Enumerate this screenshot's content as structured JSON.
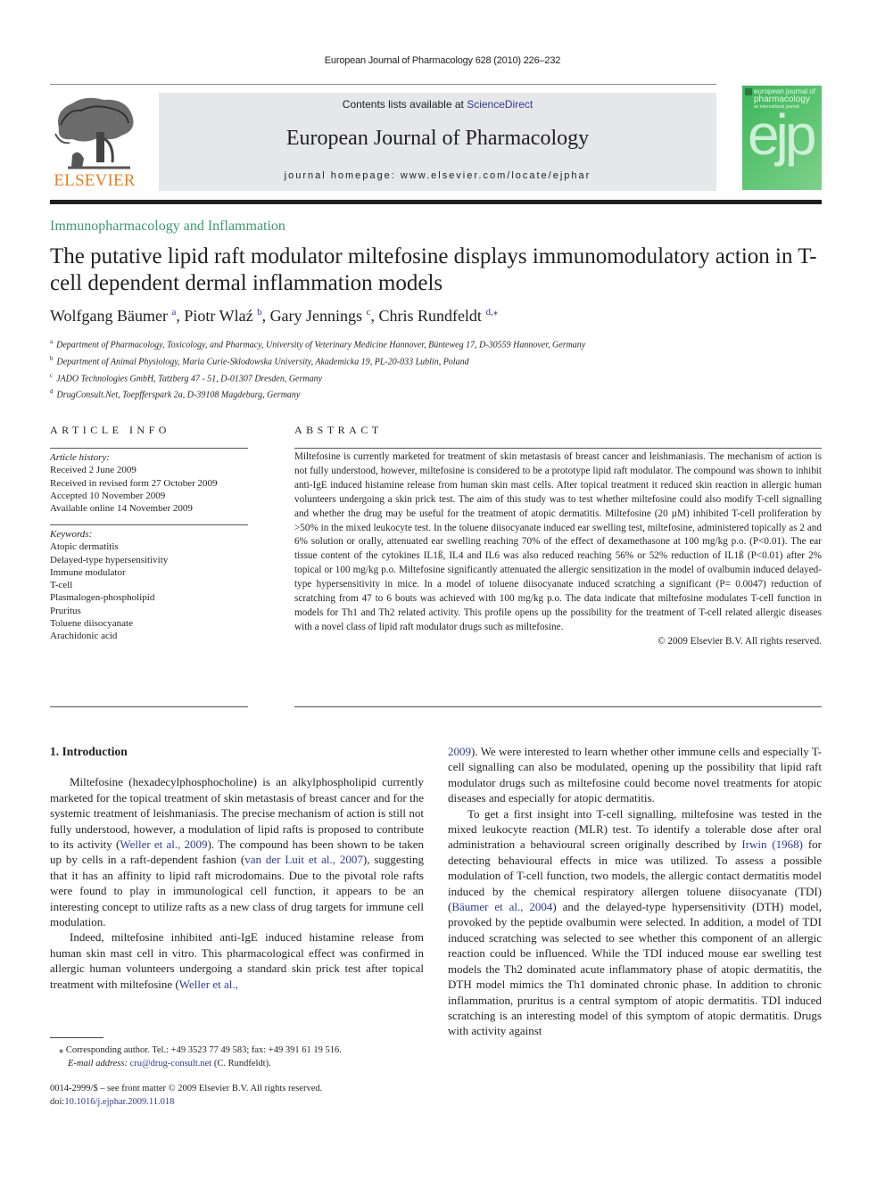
{
  "running_head": "European Journal of Pharmacology 628 (2010) 226–232",
  "masthead": {
    "publisher_logo_text": "ELSEVIER",
    "contents_prefix": "Contents lists available at ",
    "contents_link": "ScienceDirect",
    "journal_name": "European Journal of Pharmacology",
    "homepage": "journal homepage: www.elsevier.com/locate/ejphar",
    "cover": {
      "line1": "european journal of",
      "line2": "pharmacology",
      "line3": "an international journal",
      "monogram": "ejp",
      "color": "#3cb55a"
    }
  },
  "section": "Immunopharmacology and Inflammation",
  "title": "The putative lipid raft modulator miltefosine displays immunomodulatory action in T-cell dependent dermal inflammation models",
  "authors": [
    {
      "name": "Wolfgang Bäumer",
      "sup": "a",
      "sep": ", "
    },
    {
      "name": "Piotr Wlaź",
      "sup": "b",
      "sep": ", "
    },
    {
      "name": "Gary Jennings",
      "sup": "c",
      "sep": ", "
    },
    {
      "name": "Chris Rundfeldt",
      "sup": "d,⁎",
      "sep": ""
    }
  ],
  "affiliations": [
    {
      "key": "a",
      "text": "Department of Pharmacology, Toxicology, and Pharmacy, University of Veterinary Medicine Hannover, Bünteweg 17, D-30559 Hannover, Germany"
    },
    {
      "key": "b",
      "text": "Department of Animal Physiology, Maria Curie-Sklodowska University, Akademicka 19, PL-20-033 Lublin, Poland"
    },
    {
      "key": "c",
      "text": "JADO Technologies GmbH, Tatzberg 47 - 51, D-01307 Dresden, Germany"
    },
    {
      "key": "d",
      "text": "DrugConsult.Net, Toepfferspark 2a, D-39108 Magdeburg, Germany"
    }
  ],
  "article_info": {
    "heading": "ARTICLE INFO",
    "history_label": "Article history:",
    "history": [
      "Received 2 June 2009",
      "Received in revised form 27 October 2009",
      "Accepted 10 November 2009",
      "Available online 14 November 2009"
    ],
    "keywords_label": "Keywords:",
    "keywords": [
      "Atopic dermatitis",
      "Delayed-type hypersensitivity",
      "Immune modulator",
      "T-cell",
      "Plasmalogen-phospholipid",
      "Pruritus",
      "Toluene diisocyanate",
      "Arachidonic acid"
    ]
  },
  "abstract": {
    "heading": "ABSTRACT",
    "text": "Miltefosine is currently marketed for treatment of skin metastasis of breast cancer and leishmaniasis. The mechanism of action is not fully understood, however, miltefosine is considered to be a prototype lipid raft modulator. The compound was shown to inhibit anti-IgE induced histamine release from human skin mast cells. After topical treatment it reduced skin reaction in allergic human volunteers undergoing a skin prick test. The aim of this study was to test whether miltefosine could also modify T-cell signalling and whether the drug may be useful for the treatment of atopic dermatitis. Miltefosine (20 µM) inhibited T-cell proliferation by >50% in the mixed leukocyte test. In the toluene diisocyanate induced ear swelling test, miltefosine, administered topically as 2 and 6% solution or orally, attenuated ear swelling reaching 70% of the effect of dexamethasone at 100 mg/kg p.o. (P<0.01). The ear tissue content of the cytokines IL1ß, IL4 and IL6 was also reduced reaching 56% or 52% reduction of IL1ß (P<0.01) after 2% topical or 100 mg/kg p.o. Miltefosine significantly attenuated the allergic sensitization in the model of ovalbumin induced delayed-type hypersensitivity in mice. In a model of toluene diisocyanate induced scratching a significant (P= 0.0047) reduction of scratching from 47 to 6 bouts was achieved with 100 mg/kg p.o. The data indicate that miltefosine modulates T-cell function in models for Th1 and Th2 related activity. This profile opens up the possibility for the treatment of T-cell related allergic diseases with a novel class of lipid raft modulator drugs such as miltefosine.",
    "copyright": "© 2009 Elsevier B.V. All rights reserved."
  },
  "introduction": {
    "heading": "1. Introduction",
    "left_paragraphs": [
      [
        {
          "t": "Miltefosine (hexadecylphosphocholine) is an alkylphospholipid currently marketed for the topical treatment of skin metastasis of breast cancer and for the systemic treatment of leishmaniasis. The precise mechanism of action is still not fully understood, however, a modulation of lipid rafts is proposed to contribute to its activity ("
        },
        {
          "t": "Weller et al., 2009",
          "cite": true
        },
        {
          "t": "). The compound has been shown to be taken up by cells in a raft-dependent fashion ("
        },
        {
          "t": "van der Luit et al., 2007",
          "cite": true
        },
        {
          "t": "), suggesting that it has an affinity to lipid raft microdomains. Due to the pivotal role rafts were found to play in immunological cell function, it appears to be an interesting concept to utilize rafts as a new class of drug targets for immune cell modulation."
        }
      ],
      [
        {
          "t": "Indeed, miltefosine inhibited anti-IgE induced histamine release from human skin mast cell in vitro. This pharmacological effect was confirmed in allergic human volunteers undergoing a standard skin prick test after topical treatment with miltefosine ("
        },
        {
          "t": "Weller et al.,",
          "cite": true
        }
      ]
    ],
    "right_paragraphs": [
      [
        {
          "t": "2009",
          "cite": true
        },
        {
          "t": "). We were interested to learn whether other immune cells and especially T-cell signalling can also be modulated, opening up the possibility that lipid raft modulator drugs such as miltefosine could become novel treatments for atopic diseases and especially for atopic dermatitis."
        }
      ],
      [
        {
          "t": "To get a first insight into T-cell signalling, miltefosine was tested in the mixed leukocyte reaction (MLR) test. To identify a tolerable dose after oral administration a behavioural screen originally described by "
        },
        {
          "t": "Irwin (1968)",
          "cite": true
        },
        {
          "t": " for detecting behavioural effects in mice was utilized. To assess a possible modulation of T-cell function, two models, the allergic contact dermatitis model induced by the chemical respiratory allergen toluene diisocyanate (TDI) ("
        },
        {
          "t": "Bäumer et al., 2004",
          "cite": true
        },
        {
          "t": ") and the delayed-type hypersensitivity (DTH) model, provoked by the peptide ovalbumin were selected. In addition, a model of TDI induced scratching was selected to see whether this component of an allergic reaction could be influenced. While the TDI induced mouse ear swelling test models the Th2 dominated acute inflammatory phase of atopic dermatitis, the DTH model mimics the Th1 dominated chronic phase. In addition to chronic inflammation, pruritus is a central symptom of atopic dermatitis. TDI induced scratching is an interesting model of this symptom of atopic dermatitis. Drugs with activity against"
        }
      ]
    ]
  },
  "footnotes": {
    "corresponding": "⁎  Corresponding author. Tel.: +49 3523 77 49 583; fax: +49 391 61 19 516.",
    "email_label": "E-mail address: ",
    "email": "cru@drug-consult.net",
    "email_suffix": " (C. Rundfeldt).",
    "issn_line": "0014-2999/$ – see front matter © 2009 Elsevier B.V. All rights reserved.",
    "doi_prefix": "doi:",
    "doi": "10.1016/j.ejphar.2009.11.018"
  }
}
